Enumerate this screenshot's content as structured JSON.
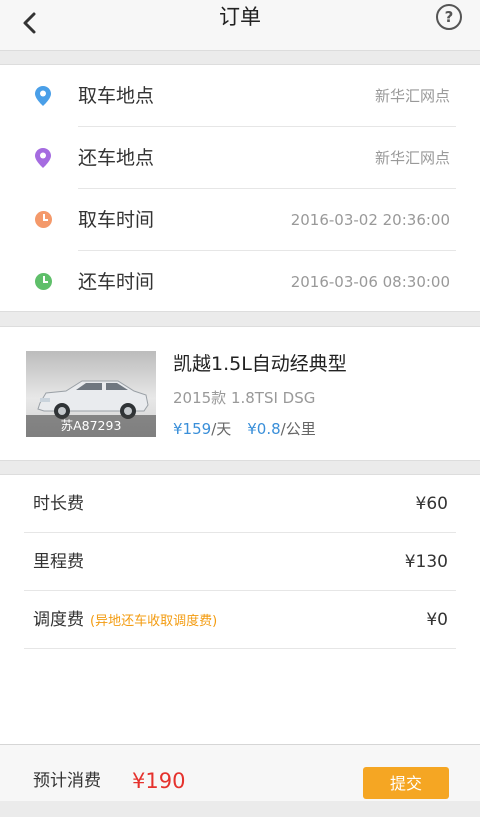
{
  "header": {
    "title": "订单",
    "back_icon": "chevron-left-icon",
    "help_icon": "question-circle-icon",
    "help_glyph": "?"
  },
  "locations": {
    "pickup_place": {
      "label": "取车地点",
      "value": "新华汇网点",
      "icon": "location-pin-icon",
      "color": "#4a9fe8"
    },
    "return_place": {
      "label": "还车地点",
      "value": "新华汇网点",
      "icon": "location-pin-icon",
      "color": "#a56ce0"
    },
    "pickup_time": {
      "label": "取车时间",
      "value": "2016-03-02 20:36:00",
      "icon": "clock-icon",
      "color": "#f4996a"
    },
    "return_time": {
      "label": "还车时间",
      "value": "2016-03-06 08:30:00",
      "icon": "clock-icon",
      "color": "#5fbf6a"
    }
  },
  "car": {
    "name": "凯越1.5L自动经典型",
    "spec": "2015款  1.8TSI DSG",
    "plate": "苏A87293",
    "day_price": "¥159",
    "day_unit": "/天",
    "km_price": "¥0.8",
    "km_unit": "/公里",
    "price_color": "#3a8fd9"
  },
  "fees": {
    "time": {
      "label": "时长费",
      "value": "¥60"
    },
    "mileage": {
      "label": "里程费",
      "value": "¥130"
    },
    "dispatch": {
      "label": "调度费",
      "note": "(异地还车收取调度费)",
      "value": "¥0"
    }
  },
  "footer": {
    "estimate_label": "预计消费",
    "estimate_value": "¥190",
    "submit_label": "提交",
    "accent": "#f5a623",
    "price_color": "#e5322d"
  }
}
